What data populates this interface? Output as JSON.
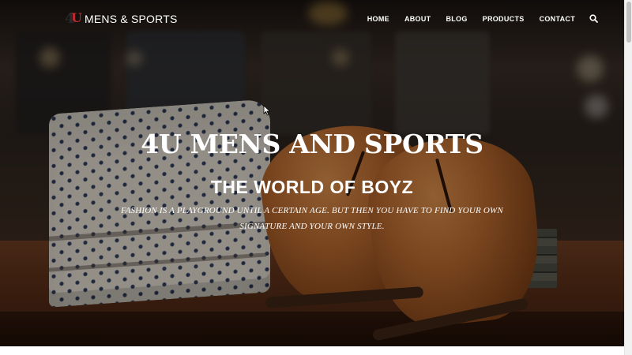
{
  "brand": {
    "logo_four": "4",
    "logo_u": "U",
    "name": "MENS & SPORTS"
  },
  "nav": {
    "items": [
      {
        "label": "HOME"
      },
      {
        "label": "ABOUT"
      },
      {
        "label": "BLOG"
      },
      {
        "label": "PRODUCTS"
      },
      {
        "label": "CONTACT"
      }
    ],
    "search_icon": "search-icon"
  },
  "hero": {
    "title": "4U MENS AND SPORTS",
    "subtitle": "THE WORLD OF BOYZ",
    "tagline": "FASHION IS A PLAYGROUND UNTIL A CERTAIN AGE. BUT THEN YOU HAVE TO FIND YOUR OWN SIGNATURE AND YOUR OWN STYLE."
  },
  "colors": {
    "logo_accent": "#c0282d",
    "text": "#ffffff"
  }
}
